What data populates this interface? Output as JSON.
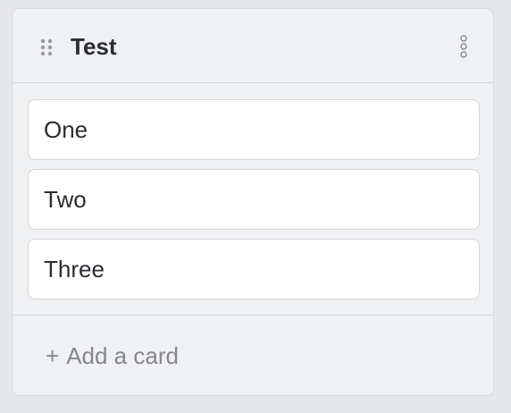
{
  "column": {
    "title": "Test",
    "drag_icon": "drag-handle-icon",
    "menu_icon": "more-vertical-icon"
  },
  "cards": [
    {
      "label": "One"
    },
    {
      "label": "Two"
    },
    {
      "label": "Three"
    }
  ],
  "footer": {
    "add_symbol": "+",
    "add_label": "Add a card"
  },
  "colors": {
    "background": "#e7e8eb",
    "column_bg": "#f0f1f3",
    "card_bg": "#ffffff",
    "text": "#2b2d31",
    "muted_text": "#85878c",
    "border": "#d6d7da"
  }
}
